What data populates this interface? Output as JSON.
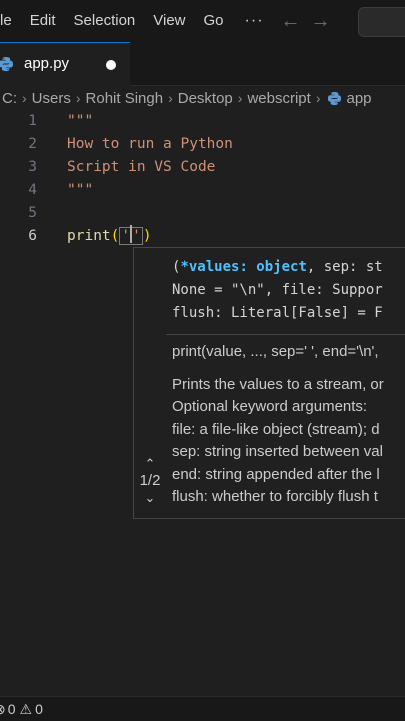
{
  "menubar": {
    "items": [
      "le",
      "Edit",
      "Selection",
      "View",
      "Go"
    ],
    "more": "···",
    "back_arrow": "←",
    "forward_arrow": "→"
  },
  "tab": {
    "icon": "python-icon",
    "label": "app.py",
    "dirty": true
  },
  "breadcrumb": {
    "items": [
      "C:",
      "Users",
      "Rohit Singh",
      "Desktop",
      "webscript",
      "app"
    ],
    "separator": "›"
  },
  "editor": {
    "lines": [
      {
        "number": "1",
        "text": "\"\"\""
      },
      {
        "number": "2",
        "text": "How to run a Python"
      },
      {
        "number": "3",
        "text": "Script in VS Code"
      },
      {
        "number": "4",
        "text": "\"\"\""
      },
      {
        "number": "5",
        "text": ""
      },
      {
        "number": "6",
        "fn": "print",
        "open": "(",
        "quote": "'",
        "close_quote": "'",
        "close": ")"
      }
    ]
  },
  "signature_help": {
    "sig_line1_open": "(",
    "sig_param": "*values: object",
    "sig_line1_rest": ", sep: st",
    "sig_line2": "None = \"\\n\", file: Suppor",
    "sig_line3": "flush: Literal[False] = F",
    "doc_signature": "print(value, ..., sep=' ', end='\\n',",
    "doc_lines": [
      "Prints the values to a stream, or",
      "Optional keyword arguments:",
      "file: a file-like object (stream); d",
      "sep: string inserted between val",
      "end: string appended after the l",
      "flush: whether to forcibly flush t"
    ],
    "counter": "1/2",
    "up_arrow": "⌃",
    "down_arrow": "⌄"
  },
  "statusbar": {
    "errors": "0",
    "warnings": "0",
    "error_icon_char": "⊗",
    "warning_icon_char": "⚠"
  },
  "colors": {
    "accent": "#0078d4",
    "string": "#ce9178",
    "function": "#dcdcaa",
    "bracket": "#ffd700"
  }
}
